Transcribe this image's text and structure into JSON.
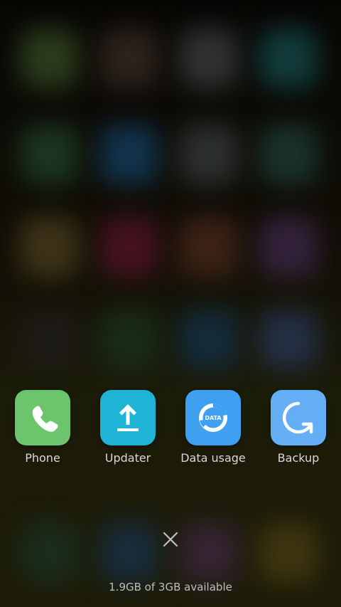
{
  "recents": {
    "apps": [
      {
        "label": "Phone",
        "color": "#6cc46c",
        "icon": "phone-icon"
      },
      {
        "label": "Updater",
        "color": "#1fb3d6",
        "icon": "upload-icon"
      },
      {
        "label": "Data usage",
        "color": "#3f9ff0",
        "icon": "data-icon",
        "icon_text": "DATA"
      },
      {
        "label": "Backup",
        "color": "#64aef5",
        "icon": "backup-icon"
      }
    ]
  },
  "memory": {
    "text": "1.9GB of 3GB available"
  },
  "colors": {
    "text": "#d8d8d8",
    "subtle": "#bdbdbd"
  }
}
